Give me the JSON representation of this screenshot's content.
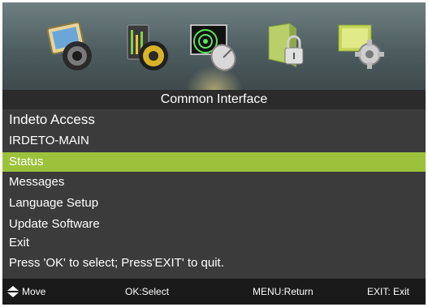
{
  "header": {
    "title": "Common Interface"
  },
  "menu": {
    "title": "Indeto Access",
    "items": [
      {
        "label": "IRDETO-MAIN"
      },
      {
        "label": "Status"
      },
      {
        "label": "Messages"
      },
      {
        "label": "Language Setup"
      },
      {
        "label": "Update Software"
      },
      {
        "label": "Exit"
      }
    ],
    "selected_index": 1
  },
  "hint": "Press 'OK' to select; Press'EXIT' to quit.",
  "footer": {
    "move": "Move",
    "ok": "OK:Select",
    "menu": "MENU:Return",
    "exit": "EXIT: Exit"
  },
  "icons": [
    "picture-icon",
    "sound-icon",
    "satellite-dish-icon",
    "lock-icon",
    "settings-gear-icon"
  ],
  "colors": {
    "selected": "#9bc23a",
    "background": "#3b3b3b",
    "footer": "#1a1a1a"
  }
}
